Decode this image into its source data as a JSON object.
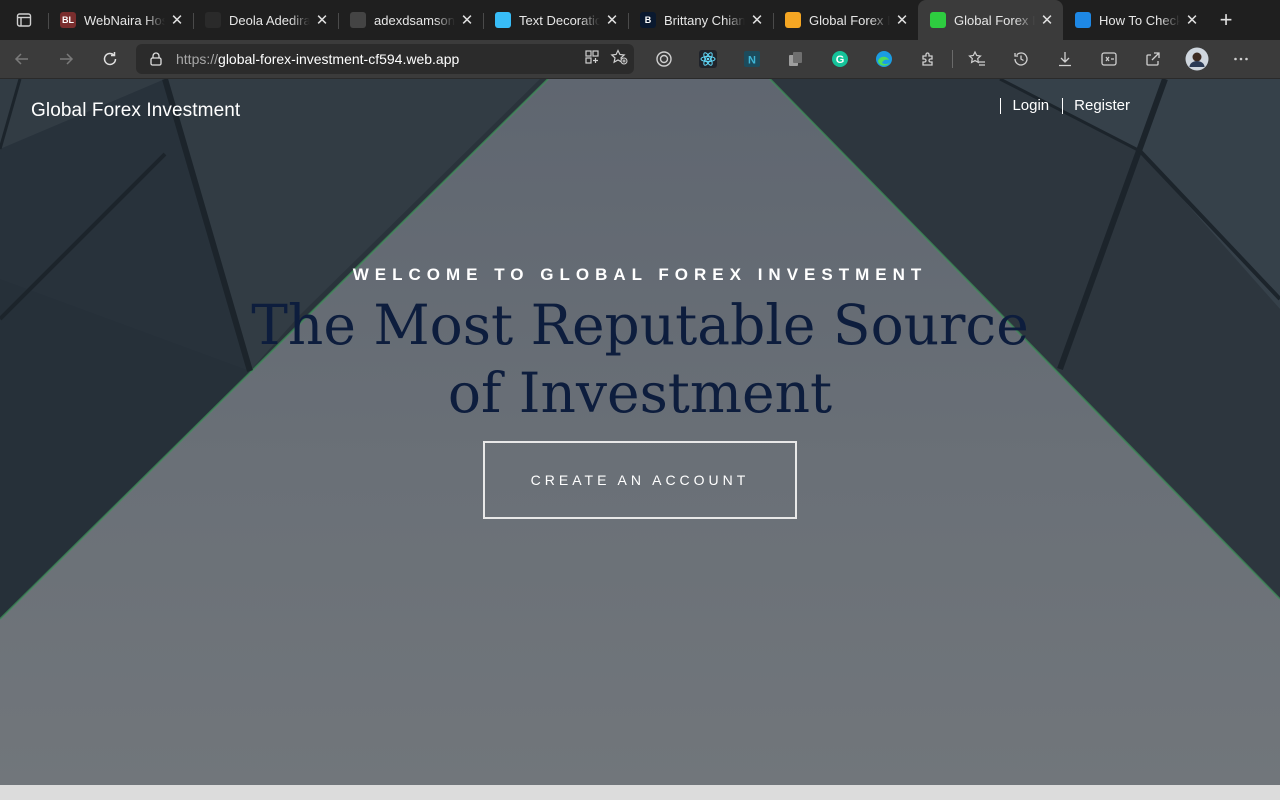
{
  "tabs": [
    {
      "title": "WebNaira Hosting",
      "favicon_text": "BL",
      "favicon_color": "#7a2e2e",
      "active": false
    },
    {
      "title": "Deola Adediran",
      "favicon_text": "",
      "favicon_color": "#2a2a2a",
      "active": false
    },
    {
      "title": "adexdsamson",
      "favicon_text": "",
      "favicon_color": "#444444",
      "active": false
    },
    {
      "title": "Text Decoration",
      "favicon_text": "",
      "favicon_color": "#38bdf8",
      "active": false
    },
    {
      "title": "Brittany Chiang",
      "favicon_text": "B",
      "favicon_color": "#0a192f",
      "active": false
    },
    {
      "title": "Global Forex Investment",
      "favicon_text": "",
      "favicon_color": "#f5a623",
      "active": false
    },
    {
      "title": "Global Forex Investment",
      "favicon_text": "",
      "favicon_color": "#2ecc40",
      "active": true
    },
    {
      "title": "How To Check",
      "favicon_text": "",
      "favicon_color": "#1e88e5",
      "active": false
    }
  ],
  "address_bar": {
    "url_prefix": "https://",
    "url_host": "global-forex-investment-cf594.web.app"
  },
  "page": {
    "brand": "Global Forex Investment",
    "nav": {
      "login": "Login",
      "register": "Register"
    },
    "eyebrow": "WELCOME TO GLOBAL FOREX INVESTMENT",
    "headline": "The Most Reputable Source of Investment",
    "cta_label": "CREATE AN ACCOUNT"
  },
  "colors": {
    "headline": "#0d1d3d",
    "tab_strip": "#1f1f1f",
    "toolbar": "#3b3b3b"
  }
}
